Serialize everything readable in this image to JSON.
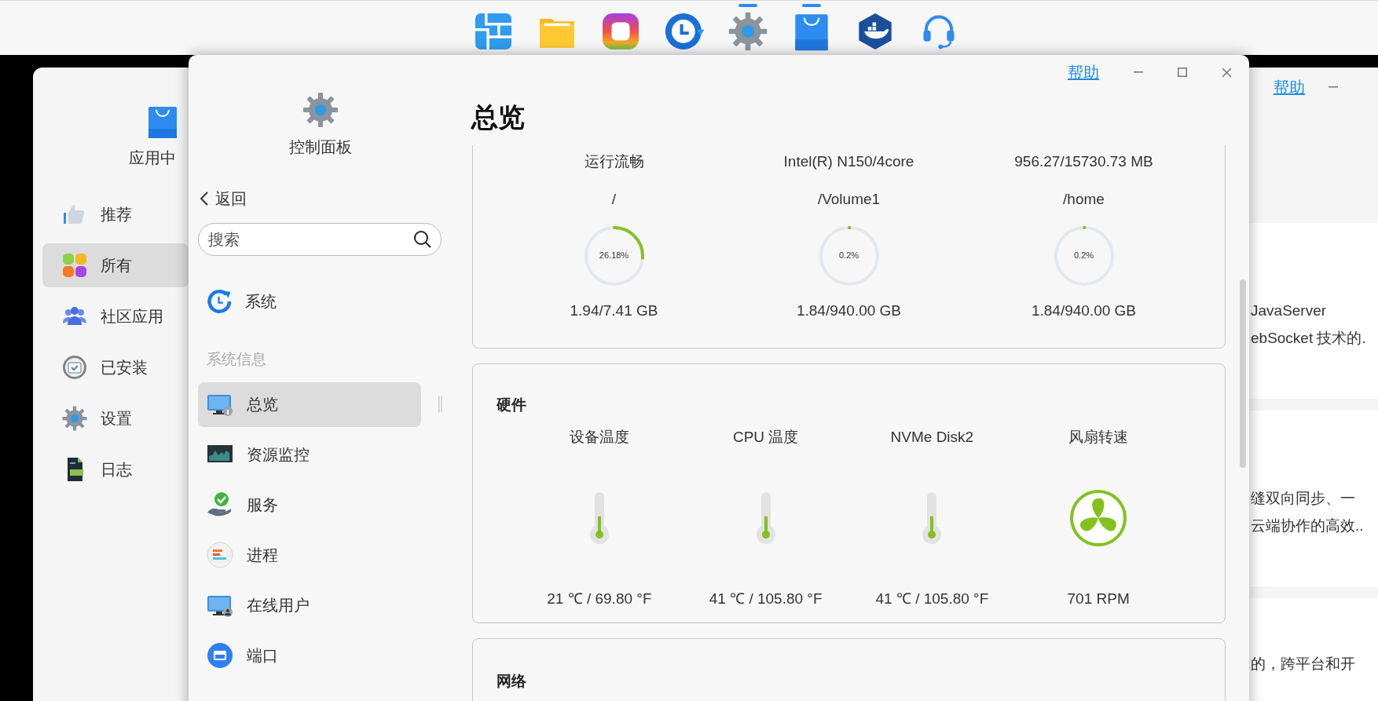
{
  "dock": {
    "items": [
      {
        "kind": "tiles",
        "running": false
      },
      {
        "kind": "folder",
        "running": false
      },
      {
        "kind": "photos",
        "running": false
      },
      {
        "kind": "backup",
        "running": false
      },
      {
        "kind": "settings",
        "running": true
      },
      {
        "kind": "store",
        "running": true
      },
      {
        "kind": "docker",
        "running": false
      },
      {
        "kind": "support",
        "running": false
      }
    ]
  },
  "app_center": {
    "title": "应用中",
    "help": "帮助",
    "nav": [
      {
        "kind": "recommend",
        "label": "推荐",
        "selected": false
      },
      {
        "kind": "all",
        "label": "所有",
        "selected": true
      },
      {
        "kind": "community",
        "label": "社区应用",
        "selected": false
      },
      {
        "kind": "installed",
        "label": "已安装",
        "selected": false
      },
      {
        "kind": "settings",
        "label": "设置",
        "selected": false
      },
      {
        "kind": "log",
        "label": "日志",
        "selected": false
      }
    ],
    "cards": [
      {
        "lines": [
          "JavaServer",
          "ebSocket 技术的."
        ]
      },
      {
        "lines": [
          "缝双向同步、一",
          "云端协作的高效.."
        ]
      },
      {
        "lines": [
          "的，跨平台和开"
        ]
      }
    ]
  },
  "control_panel": {
    "title": "控制面板",
    "back": "返回",
    "search": {
      "placeholder": "搜索"
    },
    "system": {
      "label": "系统"
    },
    "section": "系统信息",
    "items": [
      {
        "kind": "overview",
        "label": "总览",
        "selected": true
      },
      {
        "kind": "monitor",
        "label": "资源监控",
        "selected": false
      },
      {
        "kind": "service",
        "label": "服务",
        "selected": false
      },
      {
        "kind": "process",
        "label": "进程",
        "selected": false
      },
      {
        "kind": "users",
        "label": "在线用户",
        "selected": false
      },
      {
        "kind": "port",
        "label": "端口",
        "selected": false
      }
    ]
  },
  "overview": {
    "title": "总览",
    "help": "帮助",
    "status_row": [
      "运行流畅",
      "Intel(R) N150/4core",
      "956.27/15730.73 MB"
    ],
    "volumes": [
      {
        "name": "/",
        "percent": "26.18%",
        "level": 0.2618,
        "usage": "1.94/7.41 GB"
      },
      {
        "name": "/Volume1",
        "percent": "0.2%",
        "level": 0.002,
        "usage": "1.84/940.00 GB"
      },
      {
        "name": "/home",
        "percent": "0.2%",
        "level": 0.002,
        "usage": "1.84/940.00 GB"
      }
    ],
    "hardware": {
      "title": "硬件",
      "sensors": [
        {
          "kind": "thermometer",
          "label": "设备温度",
          "level": 0.45,
          "reading": "21 ℃ / 69.80 °F"
        },
        {
          "kind": "thermometer",
          "label": "CPU 温度",
          "level": 0.45,
          "reading": "41 ℃ / 105.80 °F"
        },
        {
          "kind": "thermometer",
          "label": "NVMe Disk2",
          "level": 0.45,
          "reading": "41 ℃ / 105.80 °F"
        },
        {
          "kind": "fan",
          "label": "风扇转速",
          "reading": "701 RPM"
        }
      ]
    },
    "network": {
      "title": "网络"
    }
  }
}
